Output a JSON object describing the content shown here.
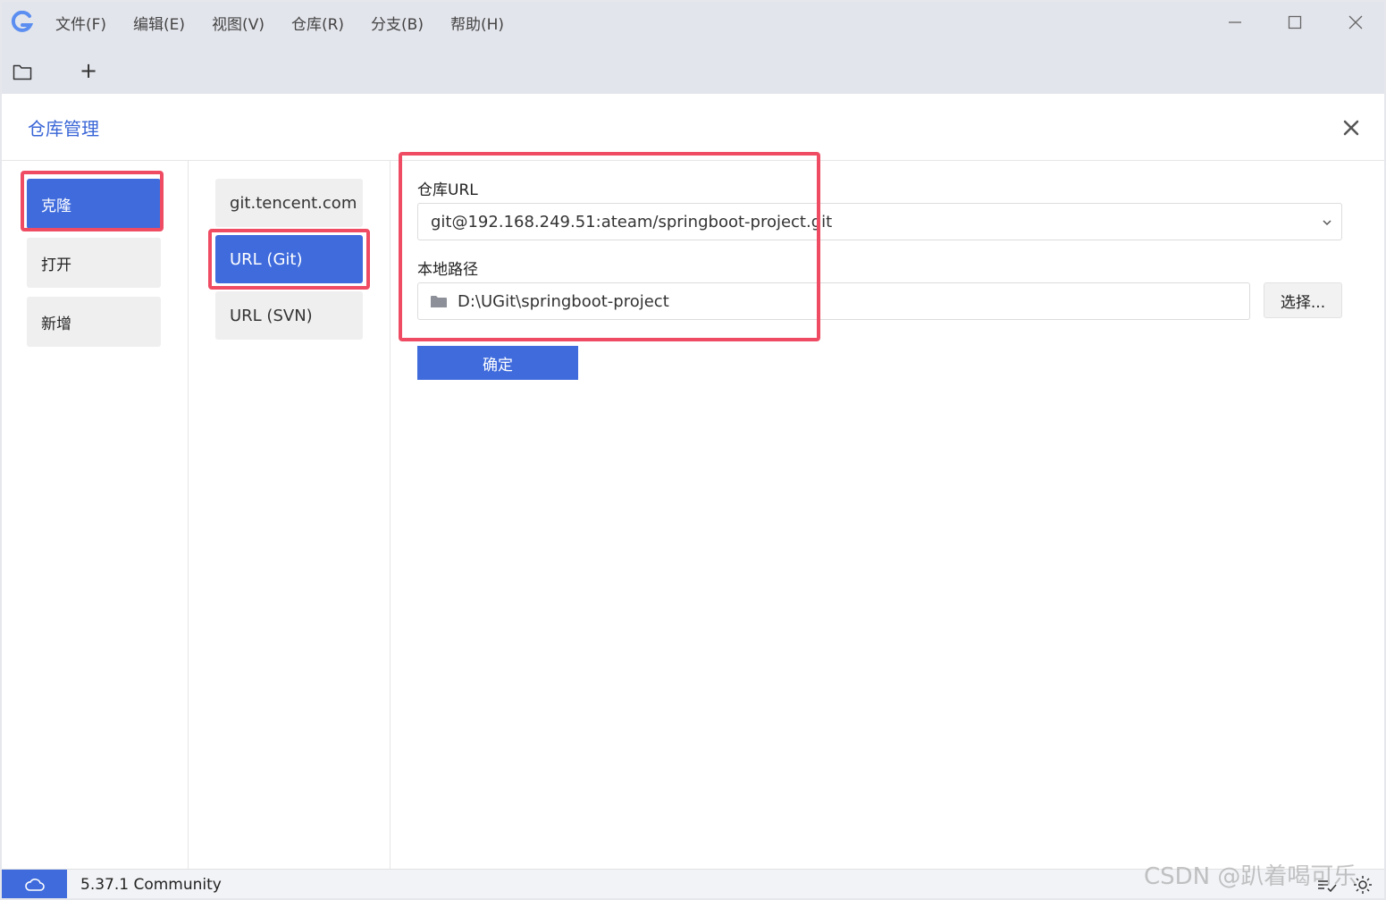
{
  "menu": {
    "items": [
      "文件(F)",
      "编辑(E)",
      "视图(V)",
      "仓库(R)",
      "分支(B)",
      "帮助(H)"
    ]
  },
  "toolbar": {
    "icons": [
      "folder-icon",
      "plus-icon"
    ],
    "add_label": "+"
  },
  "dialog": {
    "title": "仓库管理",
    "nav": [
      {
        "label": "克隆",
        "active": true
      },
      {
        "label": "打开",
        "active": false
      },
      {
        "label": "新增",
        "active": false
      }
    ],
    "sources": [
      {
        "label": "git.tencent.com",
        "active": false
      },
      {
        "label": "URL (Git)",
        "active": true
      },
      {
        "label": "URL (SVN)",
        "active": false
      }
    ],
    "form": {
      "repo_url_label": "仓库URL",
      "repo_url_value": "git@192.168.249.51:ateam/springboot-project.git",
      "local_path_label": "本地路径",
      "local_path_value": "D:\\UGit\\springboot-project",
      "choose_label": "选择...",
      "confirm_label": "确定"
    }
  },
  "status": {
    "version": "5.37.1 Community"
  },
  "watermark": "CSDN @趴着喝可乐",
  "colors": {
    "accent": "#3f6bdc",
    "highlight": "#ef4c63",
    "titlebar": "#e3e5ec"
  }
}
